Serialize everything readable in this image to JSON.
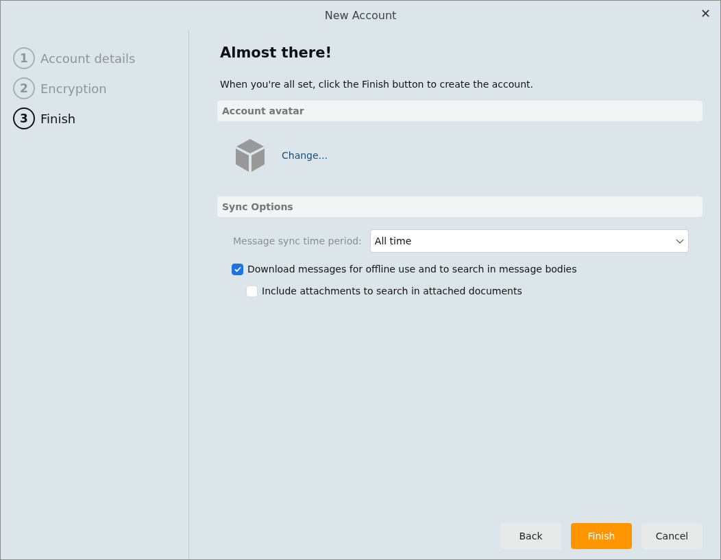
{
  "window": {
    "title": "New Account",
    "close": "✕"
  },
  "steps": [
    {
      "number": "1",
      "label": "Account details",
      "selected": false
    },
    {
      "number": "2",
      "label": "Encryption",
      "selected": false
    },
    {
      "number": "3",
      "label": "Finish",
      "selected": true
    }
  ],
  "heading": "Almost there!",
  "intro": "When you're all set, click the Finish button to create the account.",
  "avatar_section": {
    "title": "Account avatar",
    "link": "Change..."
  },
  "sync_section": {
    "title": "Sync Options",
    "field_label": "Message sync time period:",
    "field_value": "All time",
    "options": [
      {
        "label": "Download messages for offline use and to search in message bodies",
        "checked": true,
        "children": [
          {
            "label": "Include attachments to search in attached documents",
            "checked": false
          }
        ]
      }
    ]
  },
  "buttons": [
    {
      "label": "Back",
      "kind": "secondary"
    },
    {
      "label": "Finish",
      "kind": "primary"
    },
    {
      "label": "Cancel",
      "kind": "secondary"
    }
  ]
}
